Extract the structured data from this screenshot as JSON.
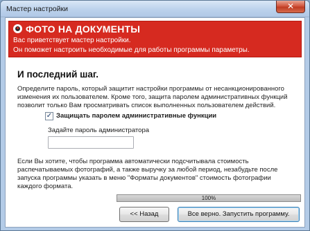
{
  "window": {
    "title": "Мастер настройки",
    "close_glyph": "✕"
  },
  "banner": {
    "title": "ФОТО НА ДОКУМЕНТЫ",
    "line1": "Вас приветствует мастер настройки.",
    "line2": "Он поможет настроить необходимые для работы программы параметры.",
    "color": "#d62a20"
  },
  "step": {
    "heading": "И последний шаг.",
    "description": "Определите пароль, который защитит настройки программы от несанкционированного изменения их пользователем. Кроме того, защита паролем административных функций позволит только Вам просматривать список выполненных пользователем действий."
  },
  "protect": {
    "checked": true,
    "check_glyph": "✓",
    "label": "Защищать паролем административные функции"
  },
  "password": {
    "label": "Задайте пароль администратора",
    "value": ""
  },
  "info": "Если Вы хотите, чтобы программа автоматически подсчитывала стоимость распечатываемых фотографий, а также выручку за любой период, незабудьте после запуска программы указать в меню \"Форматы документов\" стоимость фотографии каждого формата.",
  "progress": {
    "value": 1.0,
    "label": "100%"
  },
  "buttons": {
    "back": "<< Назад",
    "next": "Все верно. Запустить программу."
  }
}
